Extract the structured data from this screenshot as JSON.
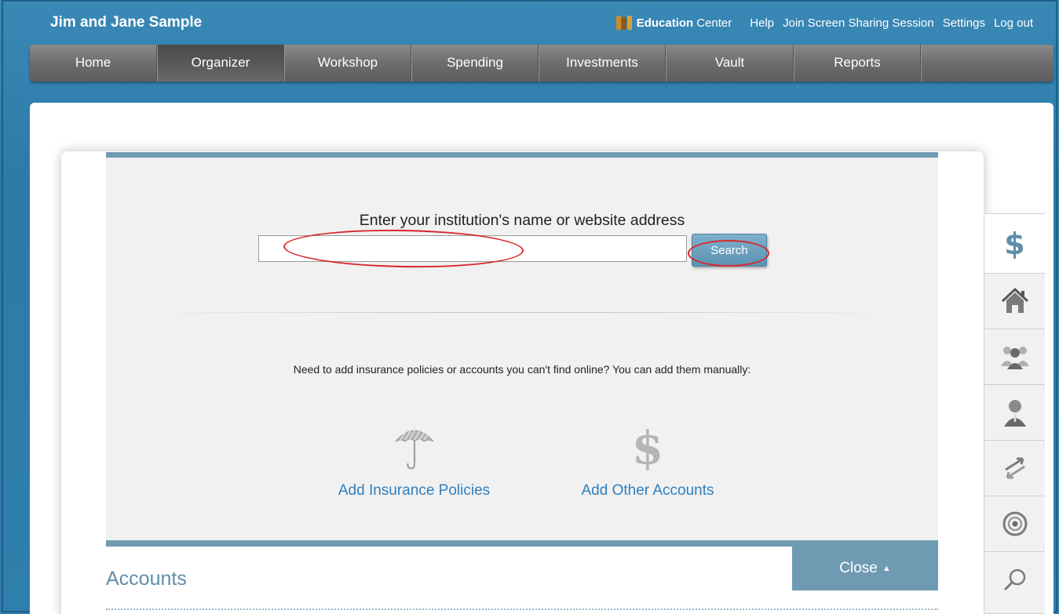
{
  "header": {
    "user_name": "Jim and Jane Sample",
    "education_bold": "Education",
    "education_rest": "Center",
    "links": [
      "Help",
      "Join Screen Sharing Session",
      "Settings",
      "Log out"
    ]
  },
  "nav": {
    "active": "Organizer",
    "items": [
      "Home",
      "Organizer",
      "Workshop",
      "Spending",
      "Investments",
      "Vault",
      "Reports"
    ]
  },
  "search": {
    "prompt": "Enter your institution's name or website address",
    "input_value": "",
    "button_label": "Search"
  },
  "manual": {
    "text": "Need to add insurance policies or accounts you can't find online? You can add them manually:",
    "add_insurance": "Add Insurance Policies",
    "add_other": "Add Other Accounts",
    "dollar_glyph": "$"
  },
  "close": {
    "label": "Close",
    "caret": "▲"
  },
  "accounts": {
    "title": "Accounts"
  },
  "side_tabs": {
    "dollar_glyph": "$",
    "icons": [
      "dollar-icon",
      "house-icon",
      "group-icon",
      "person-icon",
      "transfer-arrows-icon",
      "target-icon",
      "magnifier-icon"
    ]
  },
  "colors": {
    "background_blue": "#2f7fad",
    "nav_gray": "#6d6d6d",
    "accent_blue": "#6f9bb2",
    "link_blue": "#2e7fbf",
    "annotation_red": "#d9262a"
  }
}
